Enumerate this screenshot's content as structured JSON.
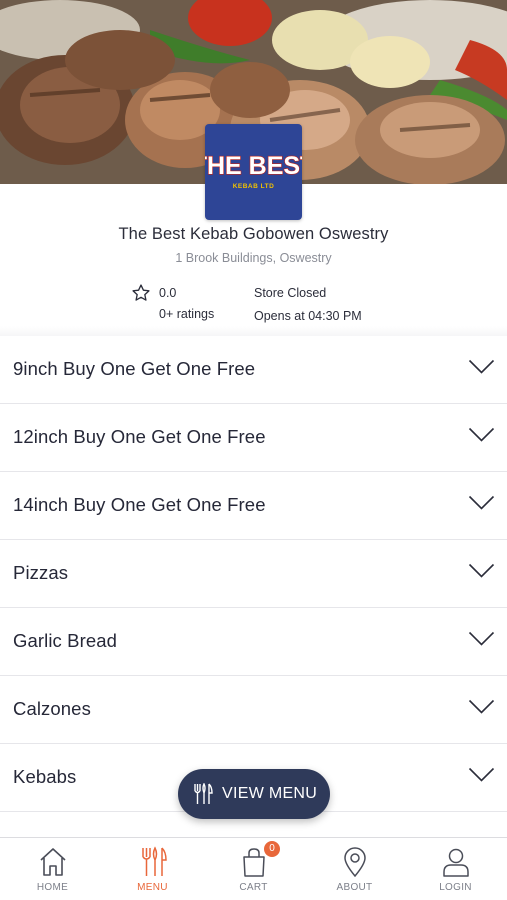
{
  "store": {
    "name": "The Best Kebab Gobowen Oswestry",
    "address": "1 Brook Buildings, Oswestry",
    "logo_title": "THE BEST",
    "logo_subtitle": "KEBAB LTD",
    "rating": "0.0",
    "ratings_count": "0+ ratings",
    "status": "Store Closed",
    "opens_at": "Opens at 04:30 PM"
  },
  "categories": [
    {
      "label": "9inch Buy One Get One Free"
    },
    {
      "label": "12inch Buy One Get One Free"
    },
    {
      "label": "14inch Buy One Get One Free"
    },
    {
      "label": "Pizzas"
    },
    {
      "label": "Garlic Bread"
    },
    {
      "label": "Calzones"
    },
    {
      "label": "Kebabs"
    }
  ],
  "view_menu": {
    "label": "VIEW MENU",
    "icon": "cutlery-icon"
  },
  "bottom_nav": {
    "items": [
      {
        "label": "HOME",
        "icon": "home-icon",
        "active": false
      },
      {
        "label": "MENU",
        "icon": "cutlery-icon",
        "active": true
      },
      {
        "label": "CART",
        "icon": "cart-bag-icon",
        "active": false,
        "badge": "0"
      },
      {
        "label": "ABOUT",
        "icon": "location-pin-icon",
        "active": false
      },
      {
        "label": "LOGIN",
        "icon": "user-icon",
        "active": false
      }
    ]
  },
  "colors": {
    "accent": "#e8673a",
    "button_bg": "#2f3a5a",
    "logo_bg": "#2e4596",
    "logo_title": "#ffffff",
    "logo_subtitle": "#f2c200",
    "text": "#262838",
    "muted": "#8a8d96"
  }
}
